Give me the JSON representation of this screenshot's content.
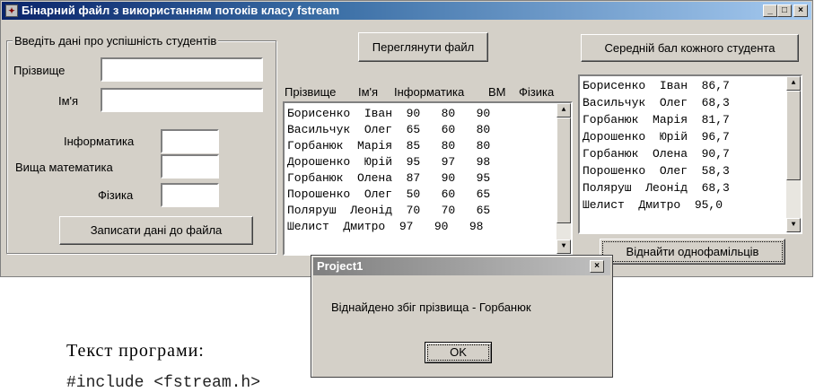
{
  "window": {
    "title": "Бінарний файл з використанням потоків класу  fstream",
    "app_icon_glyph": "✦",
    "minimize_glyph": "_",
    "maximize_glyph": "□",
    "close_glyph": "×"
  },
  "input_group": {
    "title": "Введіть дані про успішність  студентів",
    "surname_label": "Прізвище",
    "name_label": "Ім'я",
    "informatics_label": "Інформатика",
    "math_label": "Вища математика",
    "physics_label": "Фізика",
    "surname_value": "",
    "name_value": "",
    "informatics_value": "",
    "math_value": "",
    "physics_value": "",
    "write_button": "Записати дані до файла"
  },
  "file_view": {
    "view_button": "Переглянути  файл",
    "columns": [
      "Прізвище",
      "Ім'я",
      "Інформатика",
      "ВМ",
      "Фізика"
    ],
    "rows": [
      "Борисенко  Іван  90   80   90",
      "Васильчук  Олег  65   60   80",
      "Горбанюк  Марія  85   80   80",
      "Дорошенко  Юрій  95   97   98",
      "Горбанюк  Олена  87   90   95",
      "Порошенко  Олег  50   60   65",
      "Поляруш  Леонід  70   70   65",
      "Шелист  Дмитро  97   90   98"
    ]
  },
  "average_view": {
    "average_button": "Середній бал кожного студента",
    "rows": [
      "Борисенко  Іван  86,7",
      "Васильчук  Олег  68,3",
      "Горбанюк  Марія  81,7",
      "Дорошенко  Юрій  96,7",
      "Горбанюк  Олена  90,7",
      "Порошенко  Олег  58,3",
      "Поляруш  Леонід  68,3",
      "Шелист  Дмитро  95,0"
    ],
    "find_button": "Віднайти однофамільців"
  },
  "dialog": {
    "title": "Project1",
    "message": "Віднайдено збіг прізвища - Горбанюк",
    "ok_button": "OK",
    "close_glyph": "×"
  },
  "document": {
    "heading": "Текст програми:",
    "code_line": "#include <fstream.h>"
  },
  "icons": {
    "scroll_up": "▲",
    "scroll_down": "▼"
  },
  "colors": {
    "title_active_start": "#0a246a",
    "title_active_end": "#a6caf0",
    "face": "#d4d0c8"
  }
}
